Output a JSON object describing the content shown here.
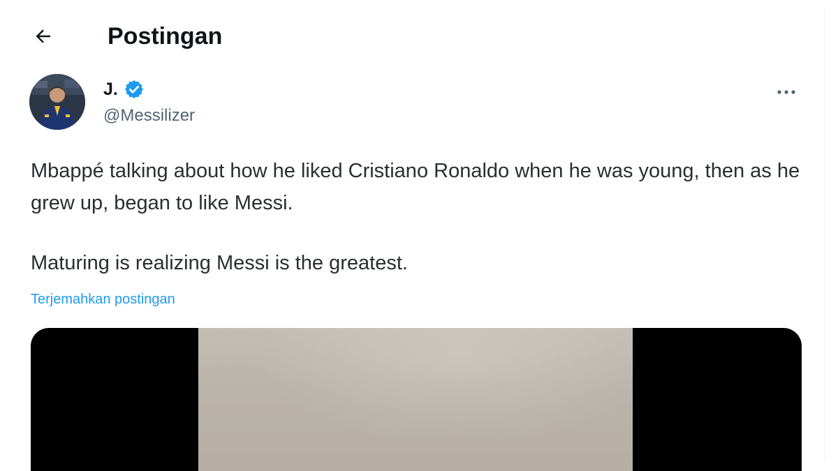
{
  "header": {
    "title": "Postingan",
    "back_icon": "arrow-left-icon"
  },
  "post": {
    "author_name": "J.",
    "author_handle": "@Messilizer",
    "verified": true,
    "verified_color": "#1d9bf0",
    "more_icon": "more-horizontal-icon",
    "text_paragraphs": [
      "Mbappé talking about how he liked Cristiano Ronaldo when he was young, then as he grew up, began to like Messi.",
      "Maturing is realizing Messi is the greatest."
    ],
    "translate_label": "Terjemahkan postingan",
    "link_color": "#1d9bf0"
  },
  "media": {
    "type": "video-thumbnail"
  }
}
